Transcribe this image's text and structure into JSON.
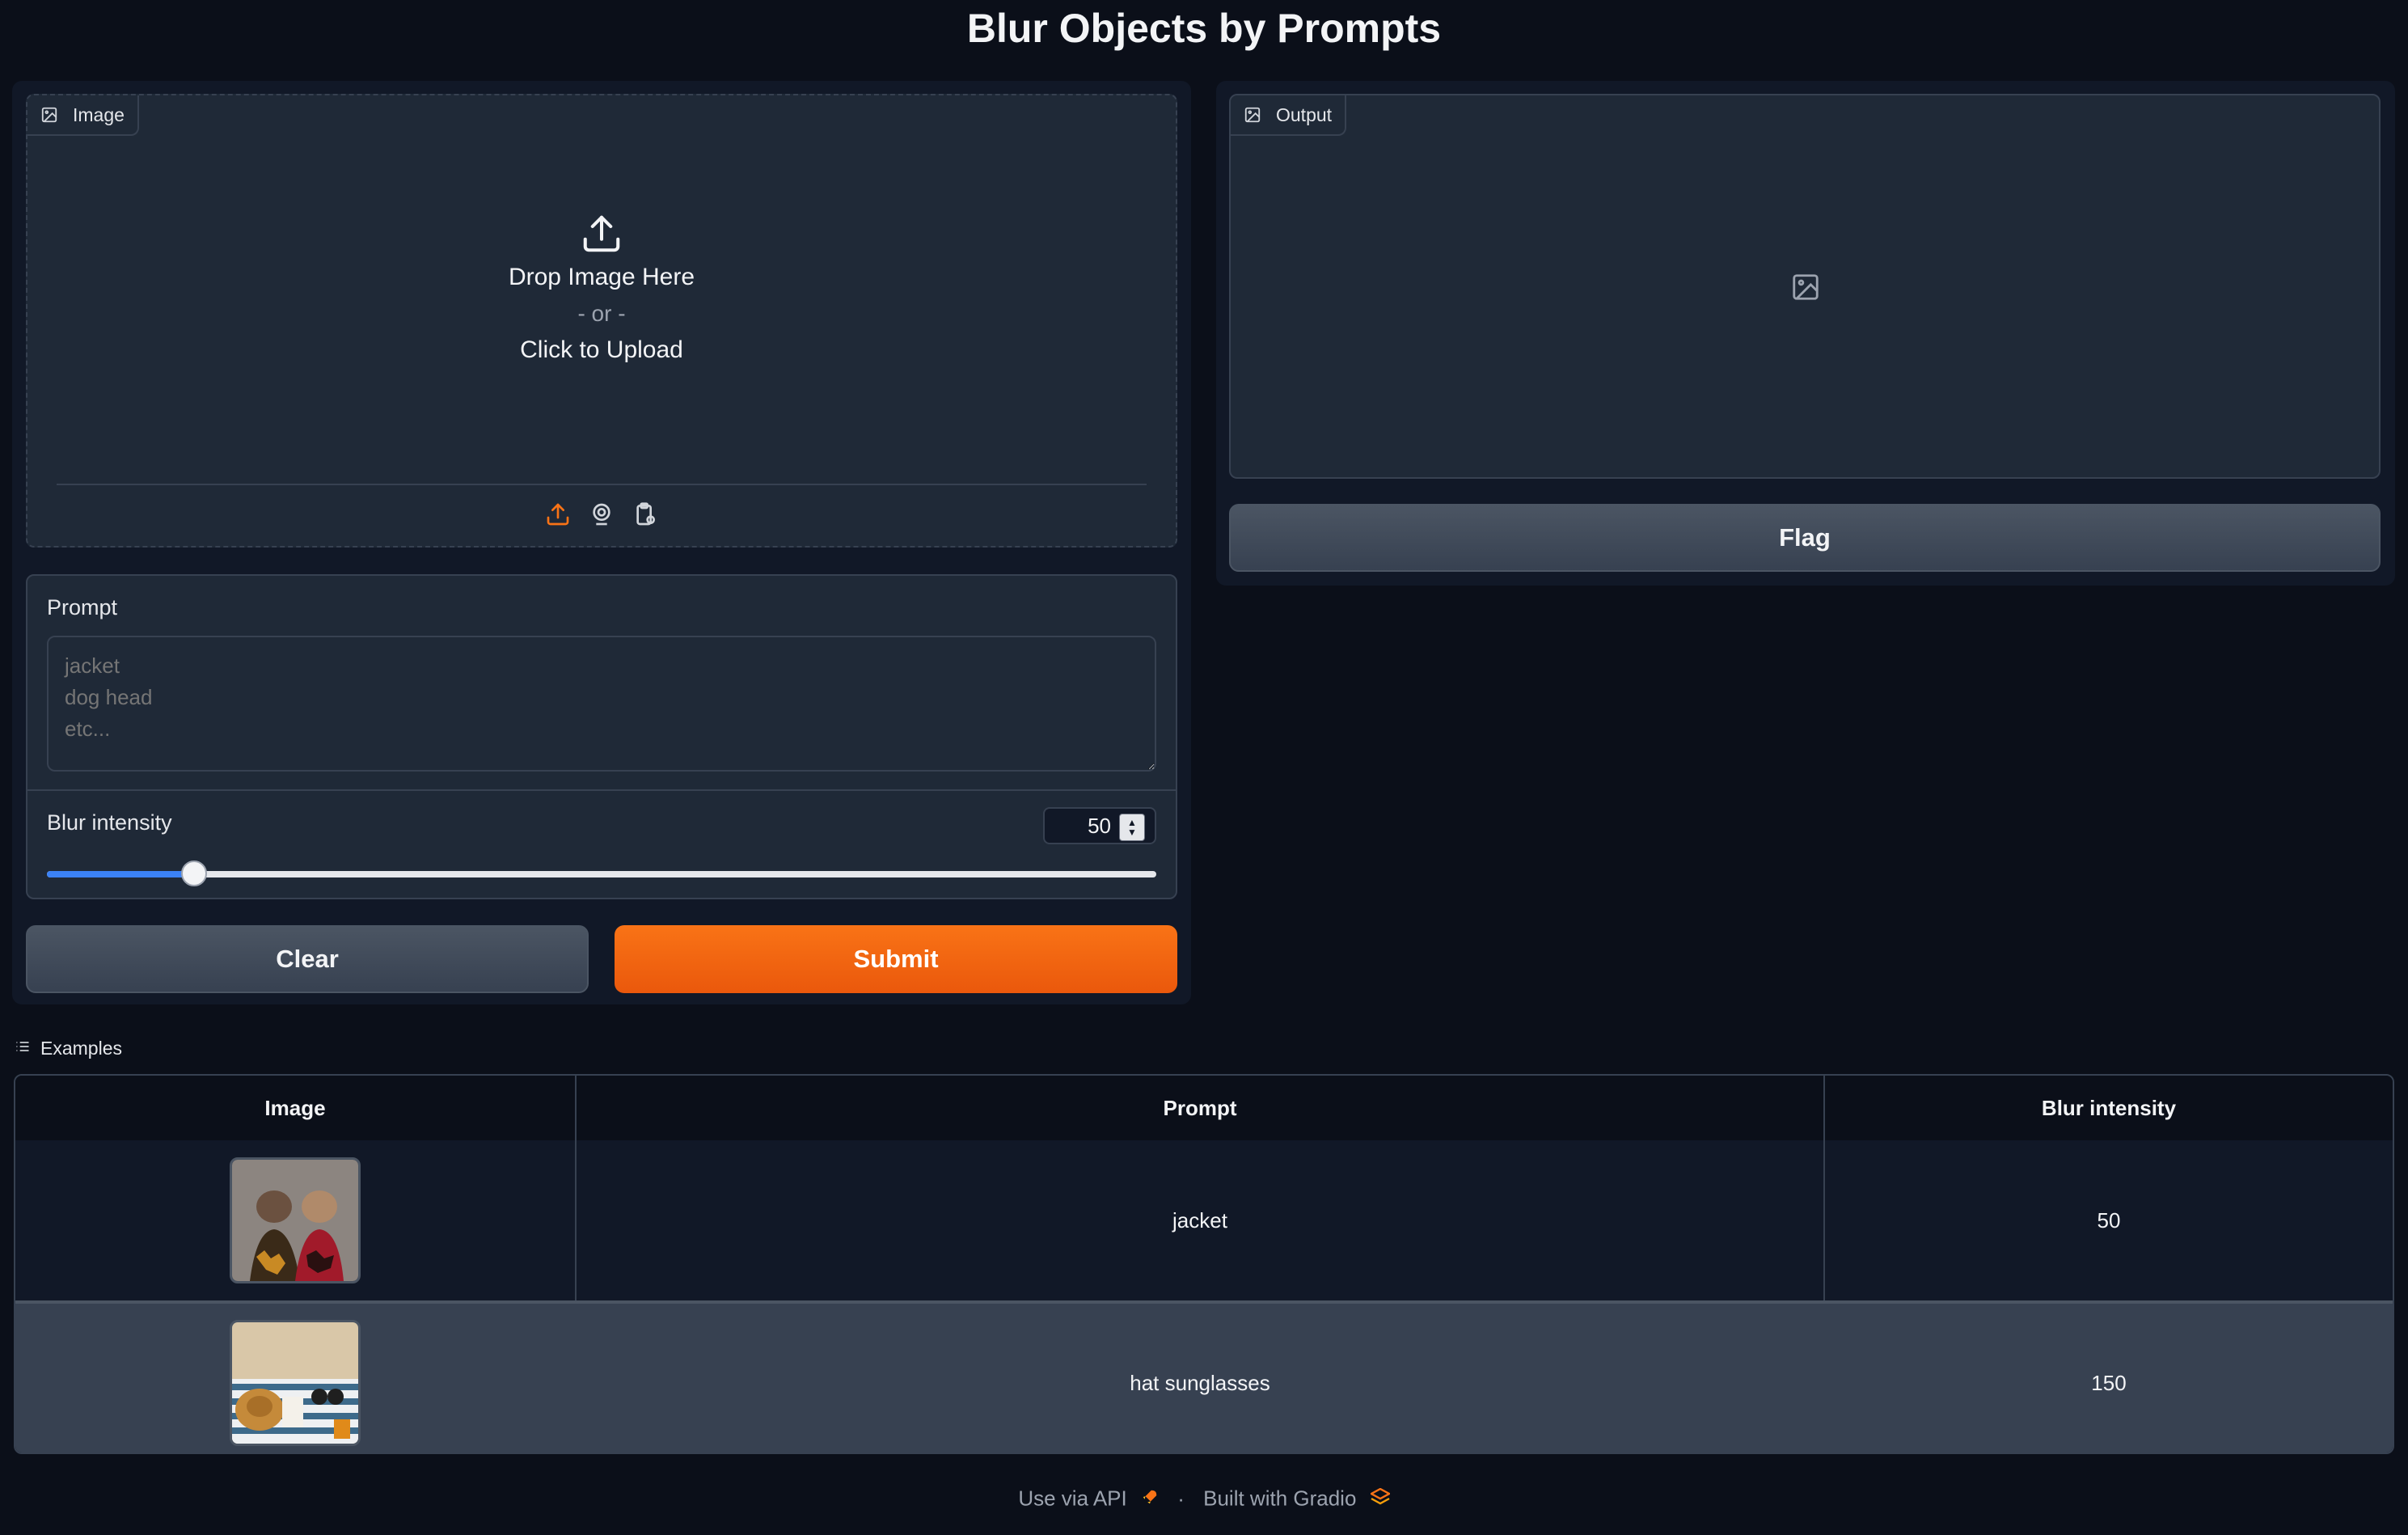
{
  "page": {
    "title": "Blur Objects by Prompts"
  },
  "image_input": {
    "label": "Image",
    "drop_text": "Drop Image Here",
    "or_text": "- or -",
    "click_text": "Click to Upload",
    "tools": [
      "upload-icon",
      "webcam-icon",
      "clipboard-icon"
    ]
  },
  "prompt": {
    "label": "Prompt",
    "placeholder": "jacket\ndog head\netc..."
  },
  "blur": {
    "label": "Blur intensity",
    "value": "50",
    "slider_fraction": 0.133
  },
  "buttons": {
    "clear": "Clear",
    "submit": "Submit",
    "flag": "Flag"
  },
  "output": {
    "label": "Output"
  },
  "examples": {
    "label": "Examples",
    "headers": [
      "Image",
      "Prompt",
      "Blur intensity"
    ],
    "rows": [
      {
        "prompt": "jacket",
        "blur": "50"
      },
      {
        "prompt": "hat sunglasses",
        "blur": "150"
      }
    ]
  },
  "footer": {
    "api": "Use via API",
    "separator": "·",
    "built": "Built with Gradio"
  },
  "colors": {
    "accent": "#f97316",
    "slider": "#3b82f6",
    "background": "#0b0f19",
    "panel": "#1f2937"
  }
}
